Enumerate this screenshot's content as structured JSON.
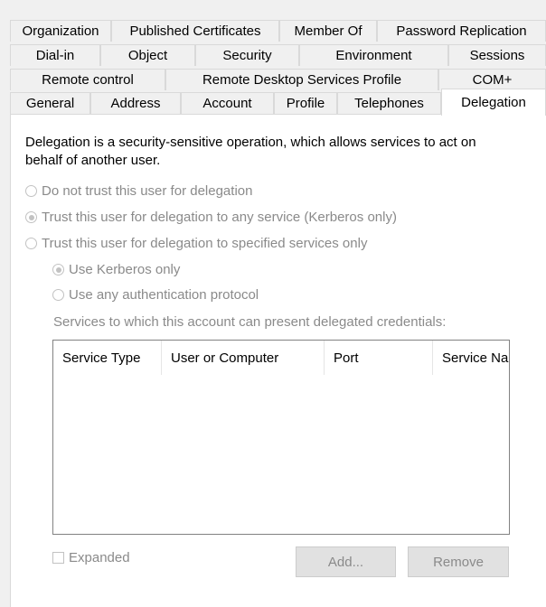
{
  "tabs": {
    "row1": [
      "Organization",
      "Published Certificates",
      "Member Of",
      "Password Replication"
    ],
    "row2": [
      "Dial-in",
      "Object",
      "Security",
      "Environment",
      "Sessions"
    ],
    "row3": [
      "Remote control",
      "Remote Desktop Services Profile",
      "COM+"
    ],
    "row4": [
      "General",
      "Address",
      "Account",
      "Profile",
      "Telephones",
      "Delegation"
    ]
  },
  "active_tab": "Delegation",
  "description": "Delegation is a security-sensitive operation, which allows services to act on behalf of another user.",
  "options": {
    "no_trust": "Do not trust this user for delegation",
    "trust_any": "Trust this user for delegation to any service (Kerberos only)",
    "trust_specified": "Trust this user for delegation to specified services only",
    "kerberos_only": "Use Kerberos only",
    "any_protocol": "Use any authentication protocol"
  },
  "selected_option": "trust_any",
  "selected_sub_option": "kerberos_only",
  "services_label": "Services to which this account can present delegated credentials:",
  "services_table": {
    "columns": [
      "Service Type",
      "User or Computer",
      "Port",
      "Service Na"
    ],
    "rows": []
  },
  "expanded_label": "Expanded",
  "buttons": {
    "add": "Add...",
    "remove": "Remove"
  }
}
